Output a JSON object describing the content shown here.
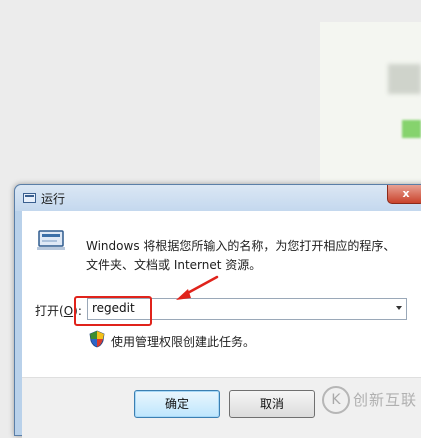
{
  "window": {
    "title": "运行",
    "close_glyph": "x"
  },
  "dialog": {
    "description_line1": "Windows 将根据您所输入的名称，为您打开相应的程序、",
    "description_line2": "文件夹、文档或 Internet 资源。",
    "open_label_prefix": "打开(",
    "open_label_hotkey": "O",
    "open_label_suffix": "):",
    "input_value": "regedit",
    "admin_note": "使用管理权限创建此任务。"
  },
  "buttons": {
    "ok_label": "确定",
    "cancel_label": "取消"
  },
  "watermark": {
    "logo_glyph": "K",
    "text": "创新互联"
  },
  "colors": {
    "annotation_red": "#e0231b",
    "title_bar": "#c4d8ee",
    "close_red": "#c9432c"
  },
  "icons": [
    "run-dialog-icon",
    "shield-icon",
    "chevron-down-icon",
    "annotation-arrow-icon"
  ]
}
